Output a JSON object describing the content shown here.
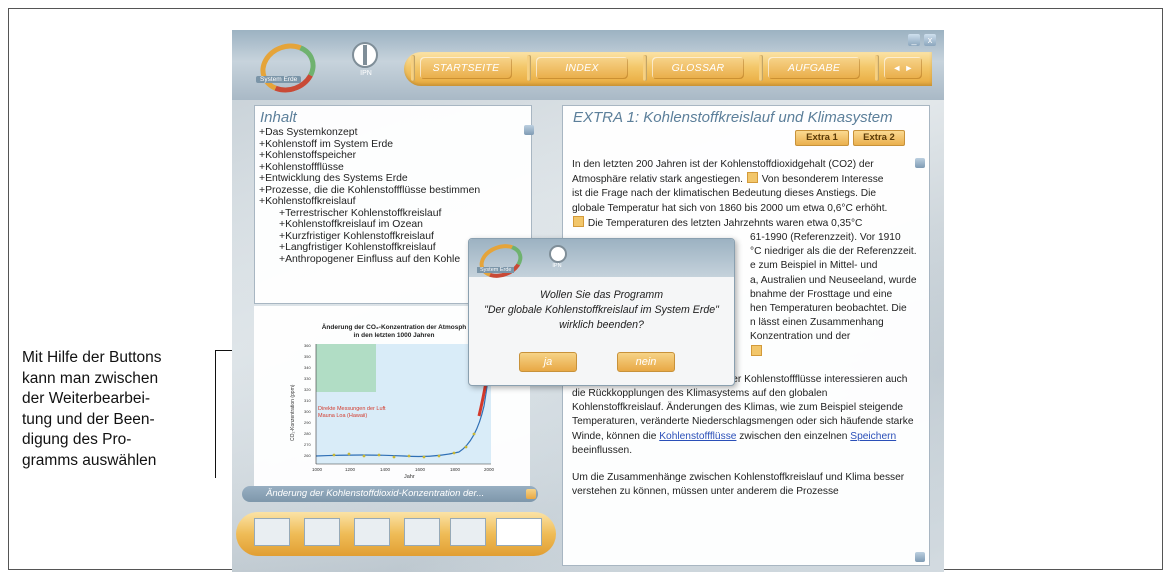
{
  "annotation": {
    "lines": [
      "Mit Hilfe der Buttons",
      "kann man zwischen",
      "der Weiterbearbei-",
      "tung und der Been-",
      "digung des Pro-",
      "gramms auswählen"
    ]
  },
  "app": {
    "logo_text": "System Erde",
    "ipn_label": "IPN",
    "nav": [
      "STARTSEITE",
      "INDEX",
      "GLOSSAR",
      "AUFGABE"
    ],
    "nav_arrows": "◄ ►",
    "win_min": "_",
    "win_close": "x"
  },
  "left_panel": {
    "title": "Inhalt",
    "items": [
      {
        "text": "+Das Systemkonzept",
        "sub": false
      },
      {
        "text": "+Kohlenstoff im System Erde",
        "sub": false
      },
      {
        "text": "+Kohlenstoffspeicher",
        "sub": false
      },
      {
        "text": "+Kohlenstoffflüsse",
        "sub": false
      },
      {
        "text": "+Entwicklung des Systems Erde",
        "sub": false
      },
      {
        "text": "+Prozesse, die die Kohlenstoffflüsse bestimmen",
        "sub": false
      },
      {
        "text": "+Kohlenstoffkreislauf",
        "sub": false
      },
      {
        "text": "+Terrestrischer Kohlenstoffkreislauf",
        "sub": true
      },
      {
        "text": "+Kohlenstoffkreislauf im Ozean",
        "sub": true
      },
      {
        "text": "+Kurzfristiger Kohlenstoffkreislauf",
        "sub": true
      },
      {
        "text": "+Langfristiger Kohlenstoffkreislauf",
        "sub": true
      },
      {
        "text": "+Anthropogener Einfluss auf den Kohle",
        "sub": true
      }
    ],
    "chart_title_1": "Änderung der CO₂-Konzentration der Atmosph",
    "chart_title_2": "in den letzten 1000 Jahren",
    "chart_legend_red_1": "Direkte Messungen der Luft",
    "chart_legend_red_2": "Mauna Loa (Hawaii)",
    "chart_xlabel": "Jahr",
    "chart_ylabel": "CO₂-Konzentration (ppm)",
    "chart_xticks": [
      "1000",
      "1200",
      "1400",
      "1600",
      "1800",
      "2000"
    ],
    "chart_yticks": [
      "360",
      "350",
      "340",
      "330",
      "320",
      "310",
      "300",
      "290",
      "280",
      "270",
      "260"
    ],
    "caption": "Änderung der Kohlenstoffdioxid-Konzentration der..."
  },
  "right_panel": {
    "title": "EXTRA 1: Kohlenstoffkreislauf und Klimasystem",
    "extra1": "Extra 1",
    "extra2": "Extra 2",
    "p1_lines": [
      "In den letzten 200 Jahren ist der Kohlenstoffdioxidgehalt (CO2) der",
      "Atmosphäre relativ stark angestiegen.",
      " Von besonderem Interesse",
      "ist die Frage nach der klimatischen Bedeutung dieses Anstiegs. Die",
      "globale Temperatur hat sich von 1860 bis 2000 um etwa 0,6°C erhöht.",
      " Die Temperaturen des letzten Jahrzehnts waren etwa 0,35°C",
      "61-1990 (Referenzzeit). Vor 1910",
      "°C niedriger als die der Referenzzeit.",
      "e zum Beispiel in Mittel- und",
      "a, Australien und Neuseeland, wurde",
      "bnahme der Frosttage und eine",
      "hen Temperaturen beobachtet. Die",
      "n lässt einen Zusammenhang",
      "Konzentration und der"
    ],
    "p2": "Neben der Klimarelevanz veränderter Kohlenstoffflüsse interessieren auch die Rückkopplungen des Klimasystems auf den globalen Kohlenstoffkreislauf. Änderungen des Klimas, wie zum Beispiel steigende Temperaturen, veränderte Niederschlagsmengen oder sich häufende starke Winde, können die",
    "p2_link1": "Kohlenstoffflüsse",
    "p2_mid": " zwischen den einzelnen ",
    "p2_link2": "Speichern",
    "p2_end": " beeinflussen.",
    "p3": "Um die Zusammenhänge zwischen Kohlenstoffkreislauf und Klima besser verstehen zu können, müssen unter anderem die Prozesse"
  },
  "dialog": {
    "logo_text": "System Erde",
    "ipn_label": "IPN",
    "line1": "Wollen Sie das Programm",
    "line2": "\"Der globale Kohlenstoffkreislauf im System Erde\"",
    "line3": "wirklich beenden?",
    "yes": "ja",
    "no": "nein"
  }
}
